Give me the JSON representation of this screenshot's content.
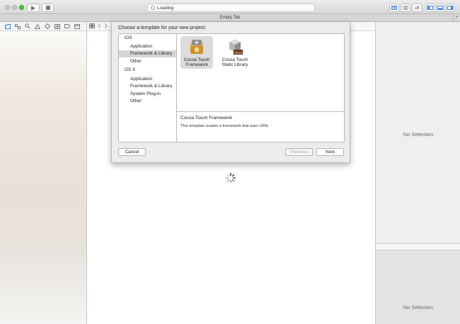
{
  "toolbar": {
    "activity_text": "Loading"
  },
  "tab": {
    "title": "Empty Tab",
    "add_label": "+"
  },
  "dialog": {
    "title": "Choose a template for your new project:",
    "sidebar": [
      {
        "label": "iOS",
        "kind": "group"
      },
      {
        "label": "Application",
        "kind": "item"
      },
      {
        "label": "Framework & Library",
        "kind": "item",
        "selected": true
      },
      {
        "label": "Other",
        "kind": "item"
      },
      {
        "label": "OS X",
        "kind": "group"
      },
      {
        "label": "Application",
        "kind": "item"
      },
      {
        "label": "Framework & Library",
        "kind": "item"
      },
      {
        "label": "System Plug-in",
        "kind": "item"
      },
      {
        "label": "Other",
        "kind": "item"
      }
    ],
    "templates": [
      {
        "line1": "Cocoa Touch",
        "line2": "Framework",
        "icon": "framework-icon",
        "selected": true
      },
      {
        "line1": "Cocoa Touch",
        "line2": "Static Library",
        "icon": "static-library-icon",
        "badge": "Touch"
      }
    ],
    "description": {
      "title": "Cocoa Touch Framework",
      "text": "This template creates a framework that uses UIKit."
    },
    "buttons": {
      "cancel": "Cancel",
      "previous": "Previous",
      "next": "Next"
    }
  },
  "inspector": {
    "top_empty": "No Selection",
    "bottom_empty": "No Selection"
  },
  "colors": {
    "accent_green": "#4cc23f",
    "selection_gray": "#d6d6d6"
  }
}
